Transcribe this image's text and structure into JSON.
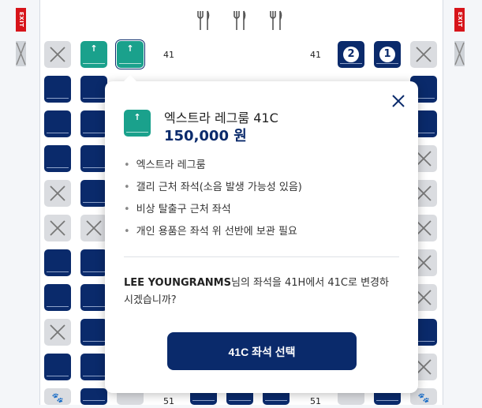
{
  "exit_sign": "EXIT",
  "row_labels": {
    "top_left": "41",
    "top_right": "41",
    "bottom_left": "51",
    "bottom_right": "51"
  },
  "seat_badges": {
    "first": "2",
    "second": "1"
  },
  "popup": {
    "title": "엑스트라 레그룸 41C",
    "price": "150,000 원",
    "features": [
      "엑스트라 레그룸",
      "갤리 근처 좌석(소음 발생 가능성 있음)",
      "비상 탈출구 근처 좌석",
      "개인 용품은 좌석 위 선반에 보관 필요"
    ],
    "passenger_name": "LEE YOUNGRANMS",
    "message_rest": "님의 좌석을 41H에서 41C로 변경하시겠습니까?",
    "button_label": "41C 좌석 선택"
  },
  "colors": {
    "navy": "#0a2a6b",
    "green": "#1aa18c",
    "exit_red": "#d7141a",
    "blocked": "#dadce0"
  }
}
